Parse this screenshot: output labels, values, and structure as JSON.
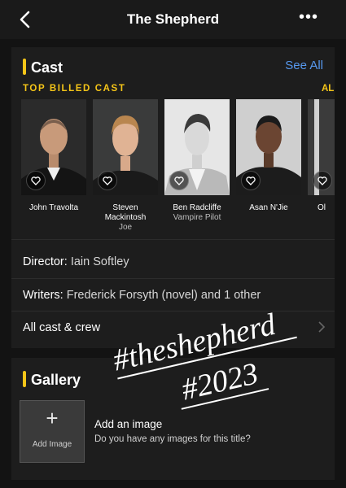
{
  "header": {
    "title": "The Shepherd",
    "back_icon": "chevron-left-icon",
    "more_label": "•••"
  },
  "cast": {
    "heading": "Cast",
    "see_all": "See All",
    "top_billed": "TOP BILLED CAST",
    "top_billed_next": "AL",
    "members": [
      {
        "name": "John Travolta",
        "role": ""
      },
      {
        "name": "Steven Mackintosh",
        "role": "Joe"
      },
      {
        "name": "Ben Radcliffe",
        "role": "Vampire Pilot"
      },
      {
        "name": "Asan N'Jie",
        "role": ""
      },
      {
        "name": "Ol",
        "role": ""
      }
    ],
    "director_label": "Director:",
    "director": "Iain Softley",
    "writers_label": "Writers:",
    "writers": "Frederick Forsyth (novel) and 1 other",
    "all_cast": "All cast & crew"
  },
  "gallery": {
    "heading": "Gallery",
    "add_image_label": "Add Image",
    "add_title": "Add an image",
    "add_subtitle": "Do you have any images for this title?"
  },
  "overlay_text": {
    "line1": "#theshepherd",
    "line2": "#2023"
  },
  "colors": {
    "accent": "#f5c518",
    "link": "#5799ef",
    "background": "#131313",
    "card": "#1d1d1d"
  }
}
